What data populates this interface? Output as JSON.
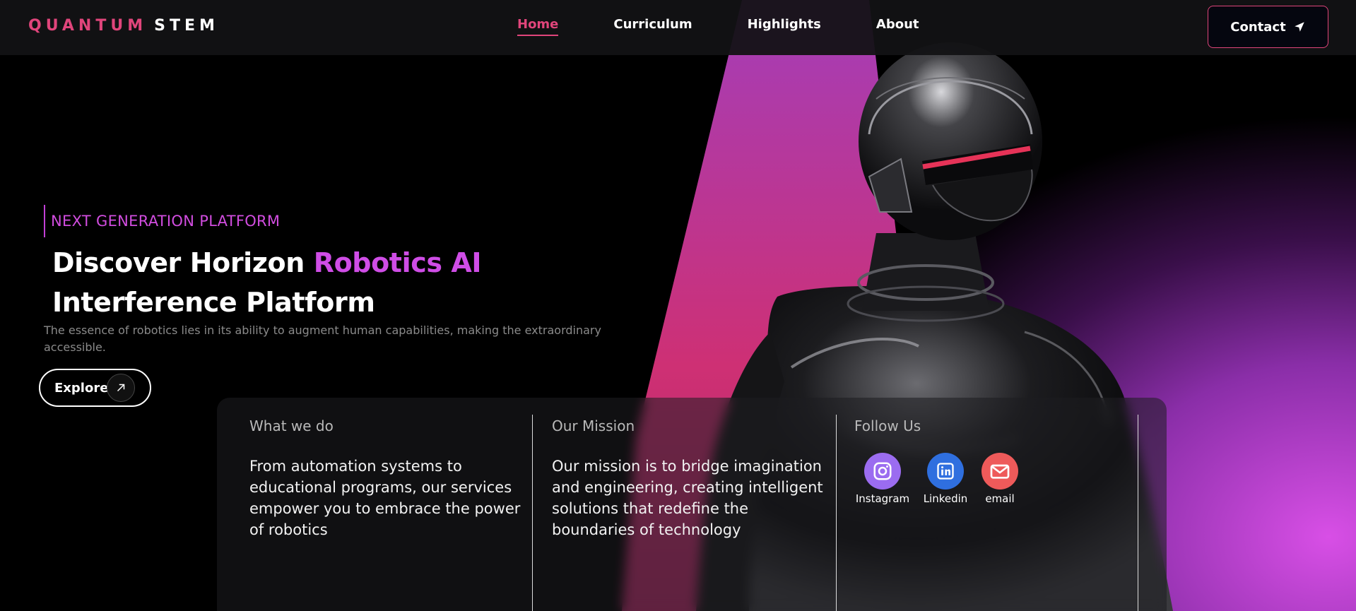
{
  "brand": {
    "part1": "QUANTUM",
    "part2": "STEM",
    "accent_color": "#e0457b"
  },
  "nav": {
    "links": [
      {
        "label": "Home",
        "active": true
      },
      {
        "label": "Curriculum",
        "active": false
      },
      {
        "label": "Highlights",
        "active": false
      },
      {
        "label": "About",
        "active": false
      }
    ],
    "contact_label": "Contact",
    "contact_icon": "send-icon"
  },
  "hero": {
    "eyebrow": "NEXT GENERATION PLATFORM",
    "headline_part1": "Discover Horizon",
    "headline_accent": "Robotics AI",
    "headline_part2": "Interference Platform",
    "subtext": "The essence of robotics lies in its ability to augment human capabilities, making the extraordinary accessible.",
    "explore_label": "Explore",
    "explore_icon": "arrow-up-right-icon"
  },
  "panel": {
    "what_we_do": {
      "title": "What we do",
      "body": "From automation systems to educational programs, our services empower you to embrace the power of robotics"
    },
    "mission": {
      "title": "Our Mission",
      "body": "Our mission is to bridge imagination and engineering, creating intelligent solutions that redefine the boundaries of technology"
    },
    "follow": {
      "title": "Follow Us",
      "socials": [
        {
          "label": "Instagram",
          "icon": "instagram-icon",
          "color": "#9b6cf0"
        },
        {
          "label": "Linkedin",
          "icon": "linkedin-icon",
          "color": "#2f6fdf"
        },
        {
          "label": "email",
          "icon": "email-icon",
          "color": "#ee5a5a"
        }
      ]
    }
  },
  "colors": {
    "accent_purple": "#cf4de6",
    "accent_pink": "#e0457b",
    "background": "#000000"
  }
}
